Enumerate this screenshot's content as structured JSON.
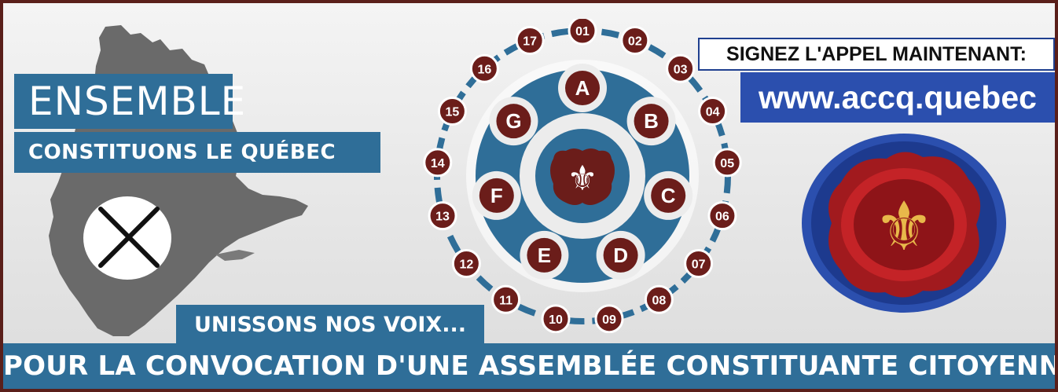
{
  "headline": "ENSEMBLE",
  "subheadline": "CONSTITUONS LE QUÉBEC",
  "slogan": "UNISSONS NOS VOIX...",
  "call_to_action": "SIGNEZ L'APPEL MAINTENANT:",
  "website": "www.accq.quebec",
  "footer": "POUR LA CONVOCATION D'UNE ASSEMBLÉE CONSTITUANTE CITOYENNE!",
  "diagram": {
    "inner_groups": [
      "A",
      "B",
      "C",
      "D",
      "E",
      "F",
      "G"
    ],
    "outer_numbers": [
      "01",
      "02",
      "03",
      "04",
      "05",
      "06",
      "07",
      "08",
      "09",
      "10",
      "11",
      "12",
      "13",
      "14",
      "15",
      "16",
      "17"
    ],
    "center_icon": "fleur-de-lis-icon"
  },
  "seal_icon": "fleur-de-lis-icon",
  "ballot_icon": "x-mark-icon",
  "colors": {
    "accent_blue": "#2f6e98",
    "url_blue": "#2b4fae",
    "maroon": "#6b1d1a",
    "map_gray": "#6a6a6a",
    "border": "#5a1f1a"
  }
}
